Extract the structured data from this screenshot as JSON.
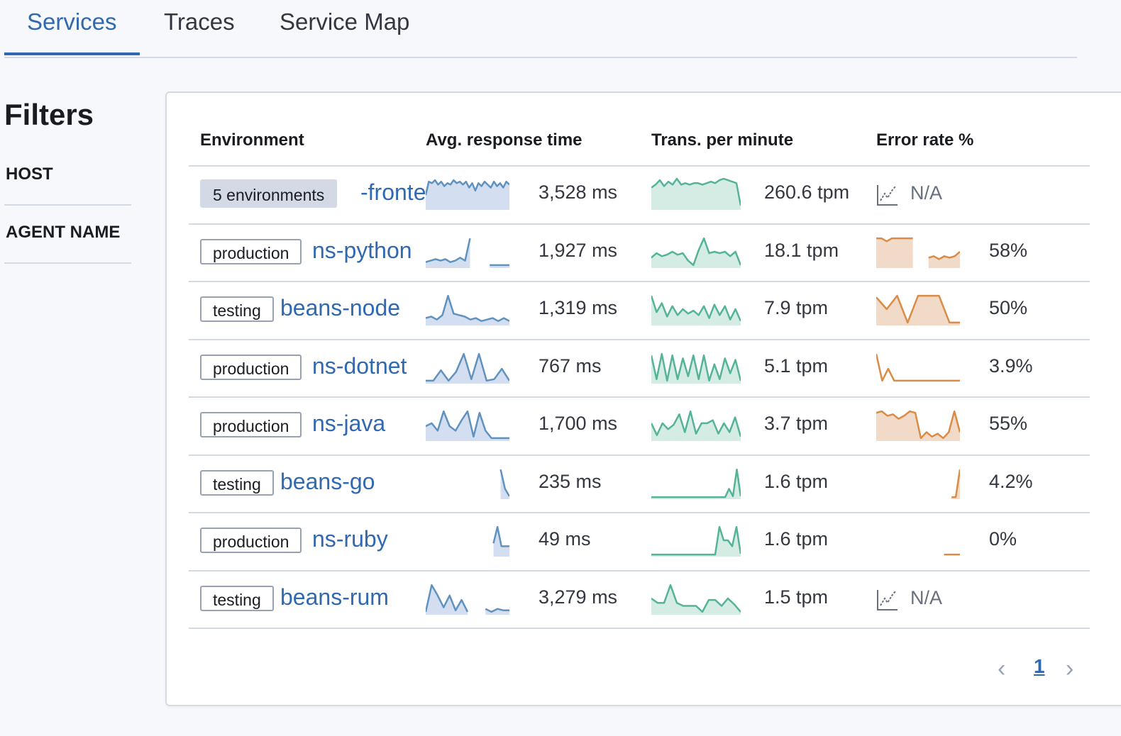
{
  "tabs": [
    {
      "label": "Services",
      "active": true
    },
    {
      "label": "Traces",
      "active": false
    },
    {
      "label": "Service Map",
      "active": false
    }
  ],
  "filters": {
    "title": "Filters",
    "groups": [
      "HOST",
      "AGENT NAME"
    ]
  },
  "table": {
    "columns": [
      "Environment",
      "Avg. response time",
      "Trans. per minute",
      "Error rate %"
    ],
    "rows": [
      {
        "env": "5 environments",
        "service": "-frontend",
        "latency": "3,528 ms",
        "throughput": "260.6 tpm",
        "error_rate": "N/A",
        "latency_series": [
          0.45,
          0.9,
          0.85,
          0.95,
          0.8,
          0.9,
          0.75,
          0.85,
          0.8,
          0.95,
          0.85,
          0.9,
          0.8,
          0.9,
          0.7,
          0.85,
          0.6,
          0.85,
          0.75,
          0.9,
          0.8,
          0.7,
          0.9,
          0.75,
          0.85,
          0.7,
          0.9,
          0.8
        ],
        "throughput_series": [
          0.7,
          0.8,
          0.95,
          0.75,
          0.9,
          0.8,
          1.0,
          0.8,
          0.85,
          0.8,
          0.85,
          0.85,
          0.8,
          0.85,
          0.9,
          0.85,
          0.95,
          1.0,
          0.95,
          0.9,
          0.85,
          0.1
        ],
        "error_series": []
      },
      {
        "env": "production",
        "service": "ns-python",
        "latency": "1,927 ms",
        "throughput": "18.1 tpm",
        "error_rate": "58%",
        "latency_series": [
          0.15,
          0.2,
          0.25,
          0.2,
          0.25,
          0.15,
          0.2,
          0.3,
          0.2,
          0.95,
          null,
          null,
          null,
          0.05,
          0.05,
          0.05,
          0.05,
          0.05
        ],
        "throughput_series": [
          0.3,
          0.45,
          0.35,
          0.4,
          0.5,
          0.4,
          0.45,
          0.2,
          0.05,
          0.55,
          0.95,
          0.45,
          0.5,
          0.45,
          0.5,
          0.35,
          0.5,
          0.05
        ],
        "error_series": [
          0.95,
          0.95,
          0.85,
          0.95,
          0.95,
          0.95,
          0.95,
          0.95,
          null,
          null,
          0.3,
          0.35,
          0.25,
          0.35,
          0.3,
          0.35,
          0.5
        ],
        "error_fill": "partial"
      },
      {
        "env": "testing",
        "service": "beans-node",
        "latency": "1,319 ms",
        "throughput": "7.9 tpm",
        "error_rate": "50%",
        "latency_series": [
          0.2,
          0.25,
          0.15,
          0.3,
          0.95,
          0.35,
          0.3,
          0.25,
          0.15,
          0.2,
          0.1,
          0.15,
          0.2,
          0.1,
          0.2,
          0.1
        ],
        "throughput_series": [
          0.95,
          0.4,
          0.7,
          0.25,
          0.6,
          0.3,
          0.5,
          0.35,
          0.45,
          0.3,
          0.6,
          0.2,
          0.65,
          0.3,
          0.6,
          0.15,
          0.5,
          0.1
        ],
        "error_series": [
          0.9,
          0.5,
          0.95,
          0.05,
          0.95,
          0.95,
          0.95,
          0.05,
          0.05
        ],
        "error_fill": "full"
      },
      {
        "env": "production",
        "service": "ns-dotnet",
        "latency": "767 ms",
        "throughput": "5.1 tpm",
        "error_rate": "3.9%",
        "latency_series": [
          0.05,
          0.05,
          0.4,
          0.05,
          0.35,
          0.95,
          0.1,
          0.95,
          0.05,
          0.1,
          0.45,
          0.05
        ],
        "throughput_series": [
          0.9,
          0.1,
          0.95,
          0.05,
          0.9,
          0.1,
          0.8,
          0.2,
          0.9,
          0.1,
          0.9,
          0.05,
          0.6,
          0.1,
          0.8,
          0.3,
          0.75,
          0.05
        ],
        "error_series": [
          0.95,
          0.05,
          0.45,
          0.05,
          0.05,
          0.05,
          0.05,
          0.05,
          0.05,
          0.05,
          0.05,
          0.05,
          0.05,
          0.05,
          0.05
        ],
        "error_fill": "none"
      },
      {
        "env": "production",
        "service": "ns-java",
        "latency": "1,700 ms",
        "throughput": "3.7 tpm",
        "error_rate": "55%",
        "latency_series": [
          0.45,
          0.55,
          0.3,
          0.95,
          0.45,
          0.3,
          0.65,
          0.95,
          0.1,
          0.9,
          0.3,
          0.05,
          0.05,
          0.05,
          0.05
        ],
        "throughput_series": [
          0.55,
          0.15,
          0.55,
          0.35,
          0.5,
          0.85,
          0.25,
          0.95,
          0.2,
          0.55,
          0.55,
          0.65,
          0.2,
          0.55,
          0.25,
          0.75,
          0.1
        ],
        "error_series": [
          0.9,
          0.95,
          0.8,
          0.85,
          0.7,
          0.8,
          0.95,
          0.9,
          0.05,
          0.25,
          0.1,
          0.2,
          0.05,
          0.25,
          0.95,
          0.25
        ],
        "error_fill": "full"
      },
      {
        "env": "testing",
        "service": "beans-go",
        "latency": "235 ms",
        "throughput": "1.6 tpm",
        "error_rate": "4.2%",
        "latency_series": [
          null,
          null,
          null,
          null,
          null,
          null,
          null,
          null,
          null,
          null,
          null,
          null,
          null,
          null,
          null,
          null,
          null,
          0.95,
          0.3,
          0.05
        ],
        "throughput_series": [
          0.02,
          0.02,
          0.02,
          0.02,
          0.02,
          0.02,
          0.02,
          0.02,
          0.02,
          0.02,
          0.02,
          0.02,
          0.02,
          0.02,
          0.02,
          0.02,
          0.02,
          0.02,
          0.02,
          0.02,
          0.3,
          0.05,
          0.95,
          0.05
        ],
        "error_series": [
          null,
          null,
          null,
          null,
          null,
          null,
          null,
          null,
          null,
          null,
          null,
          null,
          null,
          null,
          null,
          null,
          null,
          null,
          0.02,
          0.02,
          0.95
        ],
        "error_fill": "full"
      },
      {
        "env": "production",
        "service": "ns-ruby",
        "latency": "49 ms",
        "throughput": "1.6 tpm",
        "error_rate": "0%",
        "latency_series": [
          null,
          null,
          null,
          null,
          null,
          null,
          null,
          null,
          null,
          null,
          null,
          null,
          null,
          null,
          null,
          null,
          null,
          0.4,
          0.95,
          0.3,
          0.3,
          0.3
        ],
        "throughput_series": [
          0.02,
          0.02,
          0.02,
          0.02,
          0.02,
          0.02,
          0.02,
          0.02,
          0.02,
          0.02,
          0.02,
          0.02,
          0.02,
          0.02,
          0.02,
          0.02,
          0.95,
          0.5,
          0.5,
          0.3,
          0.95,
          0.05
        ],
        "error_series": [
          null,
          null,
          null,
          null,
          null,
          null,
          null,
          null,
          null,
          null,
          null,
          null,
          null,
          null,
          null,
          null,
          null,
          0.02,
          0.02,
          0.02,
          0.02,
          0.02
        ],
        "error_fill": "none"
      },
      {
        "env": "testing",
        "service": "beans-rum",
        "latency": "3,279 ms",
        "throughput": "1.5 tpm",
        "error_rate": "N/A",
        "latency_series": [
          0.05,
          0.95,
          0.6,
          0.2,
          0.6,
          0.1,
          0.45,
          0.05,
          null,
          null,
          0.15,
          0.05,
          0.15,
          0.1,
          0.1
        ],
        "throughput_series": [
          0.5,
          0.35,
          0.35,
          0.95,
          0.35,
          0.25,
          0.25,
          0.25,
          0.05,
          0.45,
          0.45,
          0.25,
          0.5,
          0.3,
          0.05
        ],
        "error_series": []
      }
    ]
  },
  "pagination": {
    "prev": "‹",
    "current": "1",
    "next": "›"
  },
  "colors": {
    "latency": "#6092c0",
    "latency_fill": "#d3dff0",
    "throughput": "#54b399",
    "throughput_fill": "#d4ece3",
    "error": "#da8b45",
    "error_fill": "#f2dac9",
    "link": "#3169b0",
    "accent": "#3169b0"
  }
}
